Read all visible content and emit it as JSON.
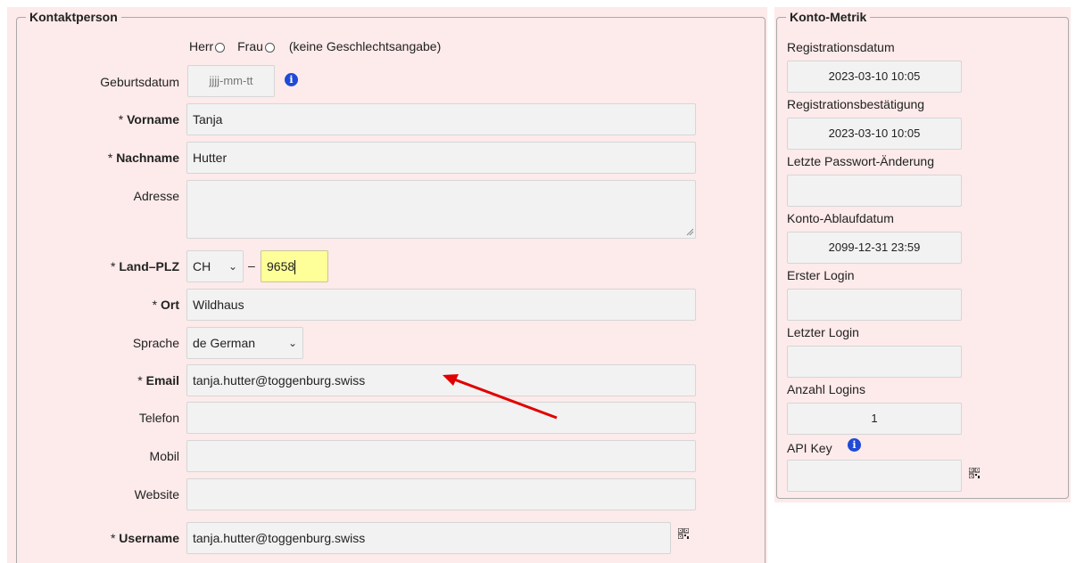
{
  "contact": {
    "legend": "Kontaktperson",
    "salutation": {
      "herr": "Herr",
      "frau": "Frau",
      "none": "(keine Geschlechtsangabe)"
    },
    "birthdate": {
      "label": "Geburtsdatum",
      "placeholder": "jjjj-mm-tt"
    },
    "firstname": {
      "star": "* ",
      "label": "Vorname",
      "value": "Tanja"
    },
    "lastname": {
      "star": "* ",
      "label": "Nachname",
      "value": "Hutter"
    },
    "address": {
      "label": "Adresse",
      "value": ""
    },
    "country_zip": {
      "star": "* ",
      "label": "Land–PLZ",
      "country": "CH",
      "dash": "–",
      "zip": "9658"
    },
    "city": {
      "star": "* ",
      "label": "Ort",
      "value": "Wildhaus"
    },
    "language": {
      "label": "Sprache",
      "value": "de German"
    },
    "email": {
      "star": "* ",
      "label": "Email",
      "value": "tanja.hutter@toggenburg.swiss"
    },
    "phone": {
      "label": "Telefon",
      "value": ""
    },
    "mobile": {
      "label": "Mobil",
      "value": ""
    },
    "website": {
      "label": "Website",
      "value": ""
    },
    "username": {
      "star": "* ",
      "label": "Username",
      "value": "tanja.hutter@toggenburg.swiss"
    }
  },
  "metrics": {
    "legend": "Konto-Metrik",
    "registration_date": {
      "label": "Registrationsdatum",
      "value": "2023-03-10 10:05"
    },
    "registration_confirm": {
      "label": "Registrationsbestätigung",
      "value": "2023-03-10 10:05"
    },
    "last_pw_change": {
      "label": "Letzte Passwort-Änderung",
      "value": ""
    },
    "expiry": {
      "label": "Konto-Ablaufdatum",
      "value": "2099-12-31 23:59"
    },
    "first_login": {
      "label": "Erster Login",
      "value": ""
    },
    "last_login": {
      "label": "Letzter Login",
      "value": ""
    },
    "login_count": {
      "label": "Anzahl Logins",
      "value": "1"
    },
    "api_key": {
      "label": "API Key",
      "value": ""
    }
  },
  "icons": {
    "info": "info-icon",
    "qr": "qr-code-icon",
    "chevron": "chevron-down-icon",
    "arrow": "red-arrow-annotation"
  },
  "colors": {
    "panel_bg": "#fdeaea",
    "info_blue": "#1f4ad6",
    "highlight_yellow": "#ffff99",
    "arrow_red": "#e00000"
  }
}
